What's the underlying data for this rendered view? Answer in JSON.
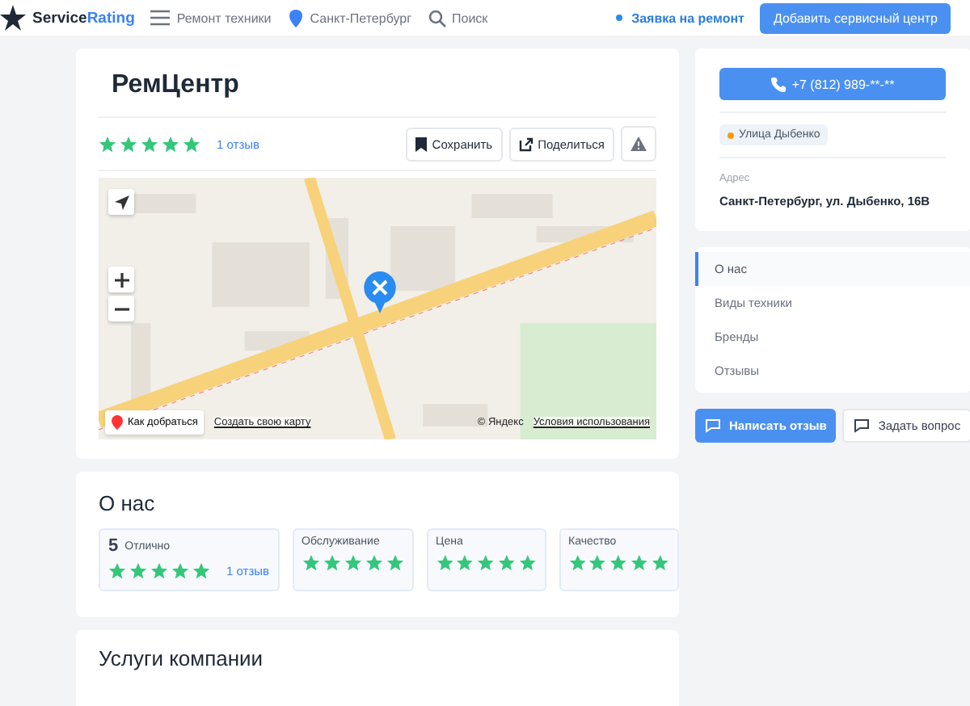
{
  "header": {
    "logo": {
      "text": "Service",
      "accent": "Rating"
    },
    "nav": [
      {
        "kind": "menu",
        "label": "Ремонт техники"
      },
      {
        "kind": "city",
        "label": "Санкт-Петербург"
      },
      {
        "kind": "search",
        "label": "Поиск"
      }
    ],
    "request_link": "Заявка на ремонт",
    "add_button": "Добавить сервисный центр"
  },
  "company": {
    "title": "РемЦентр",
    "stars": 5,
    "reviews_link": "1 отзыв",
    "actions": [
      {
        "kind": "save",
        "label": "Сохранить"
      },
      {
        "kind": "share",
        "label": "Поделиться"
      },
      {
        "kind": "report"
      }
    ]
  },
  "map": {
    "route_button": "Как добраться",
    "create_link": "Создать свою карту",
    "copyright": "© Яндекс",
    "terms_link": "Условия использования"
  },
  "about": {
    "title": "О нас",
    "overall": {
      "score": "5",
      "label": "Отлично",
      "stars": 5,
      "reviews_link": "1 отзыв"
    },
    "ratings": [
      {
        "label": "Обслуживание",
        "stars": 5
      },
      {
        "label": "Цена",
        "stars": 5
      },
      {
        "label": "Качество",
        "stars": 5
      }
    ]
  },
  "services": {
    "title": "Услуги компании"
  },
  "contact": {
    "phone_button": "+7 (812) 989-**-**",
    "metro": {
      "label": "Улица Дыбенко",
      "color": "#f59e0b"
    },
    "address_label": "Адрес",
    "address": "Санкт-Петербург, ул. Дыбенко, 16В"
  },
  "side_nav": [
    {
      "label": "О нас",
      "selected": true
    },
    {
      "label": "Виды техники",
      "selected": false
    },
    {
      "label": "Бренды",
      "selected": false
    },
    {
      "label": "Отзывы",
      "selected": false
    }
  ],
  "bottom_buttons": [
    {
      "kind": "primary",
      "label": "Написать отзыв"
    },
    {
      "kind": "secondary",
      "label": "Задать вопрос"
    }
  ]
}
